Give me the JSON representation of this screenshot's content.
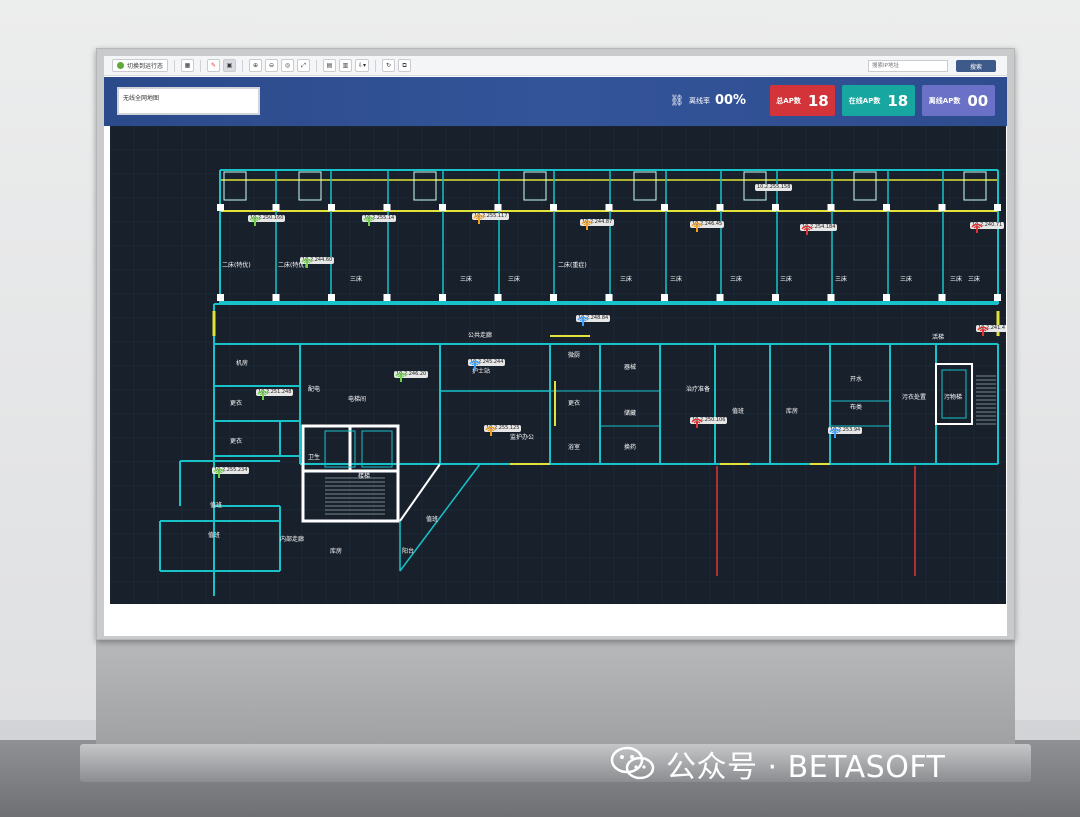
{
  "toolbar": {
    "switch_label": "切换到运行态",
    "search_placeholder": "搜索IP地址",
    "search_button": "搜索"
  },
  "header": {
    "map_select": "无线全网地图",
    "offline_rate_label": "离线率",
    "offline_rate_value": "00%",
    "total_ap_label": "总AP数",
    "total_ap_value": "18",
    "online_ap_label": "在线AP数",
    "online_ap_value": "18",
    "offline_ap_label": "离线AP数",
    "offline_ap_value": "00"
  },
  "colors": {
    "ap_green": "#6fd04a",
    "ap_orange": "#f0a020",
    "ap_red": "#e03030",
    "ap_blue": "#3aa0ff",
    "wall": "#17c2c9",
    "wall_yellow": "#e2e23a"
  },
  "access_points": [
    {
      "ip": "10.2.250.160",
      "color": "green"
    },
    {
      "ip": "10.2.244.60",
      "color": "green"
    },
    {
      "ip": "10.2.255.14",
      "color": "green"
    },
    {
      "ip": "10.2.255.117",
      "color": "orange"
    },
    {
      "ip": "10.2.244.87",
      "color": "orange"
    },
    {
      "ip": "10.2.246.45",
      "color": "orange"
    },
    {
      "ip": "10.2.254.184",
      "color": "red"
    },
    {
      "ip": "10.2.240.71",
      "color": "red"
    },
    {
      "ip": "10.2.255.158",
      "color": "none"
    },
    {
      "ip": "10.2.248.84",
      "color": "blue"
    },
    {
      "ip": "10.2.241.4",
      "color": "red"
    },
    {
      "ip": "10.2.245.244",
      "color": "blue"
    },
    {
      "ip": "10.2.246.20",
      "color": "green"
    },
    {
      "ip": "10.2.251.248",
      "color": "green"
    },
    {
      "ip": "10.2.255.125",
      "color": "orange"
    },
    {
      "ip": "10.2.250.106",
      "color": "red"
    },
    {
      "ip": "10.2.253.94",
      "color": "blue"
    },
    {
      "ip": "10.2.255.234",
      "color": "green"
    }
  ],
  "rooms": {
    "r1": "二床(特优)",
    "r2": "二床(特优)",
    "r3": "三床",
    "r4": "三床",
    "r5": "三床",
    "r6": "二床(重症)",
    "r7": "三床",
    "r8": "三床",
    "r9": "三床",
    "r10": "三床",
    "r11": "三床",
    "r12": "三床",
    "r13": "三床",
    "r14": "三床",
    "corridor": "公共走廊",
    "stairs_r": "活梯",
    "machine": "机房",
    "dist": "配电",
    "elec": "电梯间",
    "nurse": "护士站",
    "nurse_office": "监护办公",
    "kitchen": "微厨",
    "equip": "器械",
    "treat": "治疗准备",
    "dressing": "换药",
    "store": "储藏",
    "duty": "值班",
    "storage": "库房",
    "water": "开水",
    "linen": "布类",
    "dirty": "污衣处置",
    "dirty_ele": "污物梯",
    "change1": "更衣",
    "change2": "更衣",
    "lounge": "值班",
    "inner_corr": "内部走廊",
    "depot": "库房",
    "balcony": "阳台",
    "dorm": "值班",
    "changebath": "更衣",
    "stair_label": "楼梯",
    "extra": "值班",
    "shower": "浴室",
    "wc": "卫生"
  },
  "watermark": "公众号 · BETASOFT"
}
